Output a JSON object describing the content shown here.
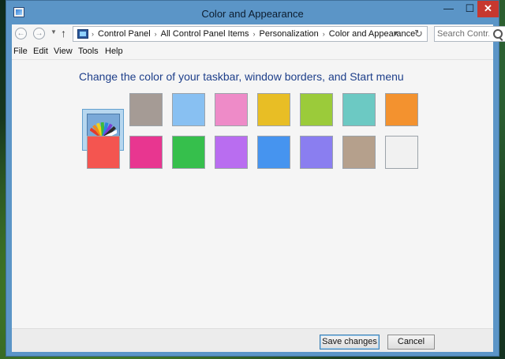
{
  "window": {
    "title": "Color and Appearance",
    "controls": {
      "minimize": "—",
      "maximize": "☐",
      "close": "✕"
    }
  },
  "nav": {
    "back_icon": "arrow-left-icon",
    "forward_icon": "arrow-right-icon",
    "up_glyph": "↑",
    "breadcrumbs": [
      "Control Panel",
      "All Control Panel Items",
      "Personalization",
      "Color and Appearance"
    ],
    "separator": "›",
    "refresh_glyph": "↻",
    "search_placeholder": "Search Contr..."
  },
  "menu": [
    "File",
    "Edit",
    "View",
    "Tools",
    "Help"
  ],
  "main": {
    "heading": "Change the color of your taskbar, window borders, and Start menu",
    "swatches_row1": [
      "auto",
      "#a59b95",
      "#88c0f2",
      "#ee8bc8",
      "#e8be25",
      "#9bcb3a",
      "#6cc9c3",
      "#f3922f"
    ],
    "swatches_row2": [
      "#f45550",
      "#e83690",
      "#36bf4c",
      "#b96df0",
      "#4694ef",
      "#8a7ef0",
      "#b5a08c",
      "#f1f1f1"
    ],
    "selected_index": 0
  },
  "footer": {
    "save_label": "Save changes",
    "cancel_label": "Cancel"
  }
}
